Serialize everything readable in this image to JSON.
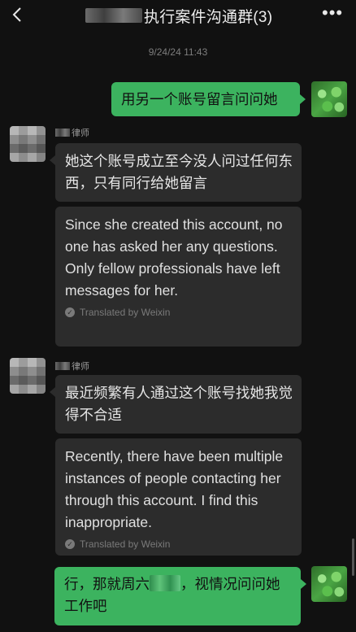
{
  "header": {
    "title": "执行案件沟通群(3)",
    "back_icon": "chevron-left-icon",
    "more_icon": "more-dots-icon",
    "more_label": "•••"
  },
  "timestamp": "9/24/24 11:43",
  "messages": [
    {
      "from": "me",
      "text": "用另一个账号留言问问她"
    },
    {
      "from": "other",
      "sender_suffix": "律师",
      "text": "她这个账号成立至今没人问过任何东西，只有同行给她留言",
      "translation": "Since she created this account, no one has asked her any questions. Only fellow professionals have left messages for her.",
      "translated_by": "Translated by Weixin"
    },
    {
      "from": "other",
      "sender_suffix": "律师",
      "text": "最近频繁有人通过这个账号找她我觉得不合适",
      "translation": "Recently, there have been multiple instances of people contacting her through this account. I find this inappropriate.",
      "translated_by": "Translated by Weixin"
    },
    {
      "from": "me",
      "text_before": "行，那就周六",
      "text_after": "，视情况问问她工作吧"
    }
  ],
  "colors": {
    "background": "#111111",
    "my_bubble": "#3cb35f",
    "their_bubble": "#2c2c2c"
  }
}
